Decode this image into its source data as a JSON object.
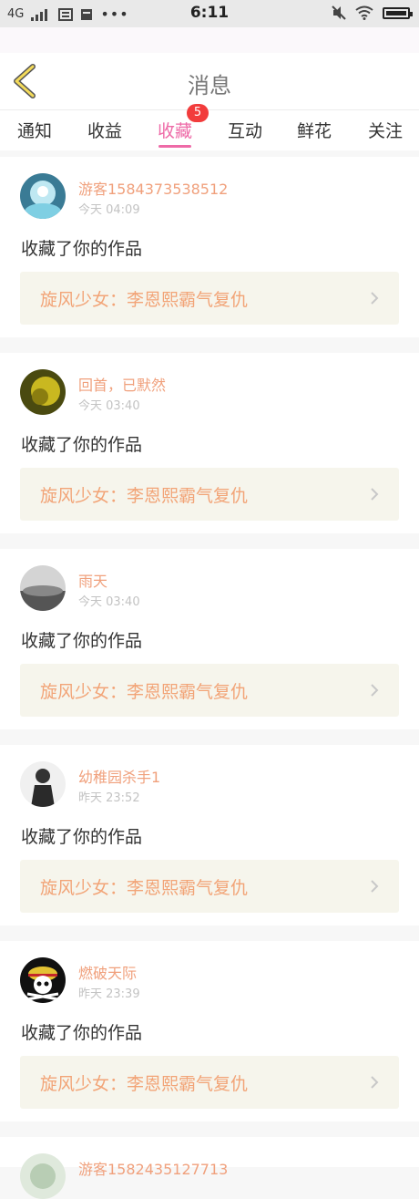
{
  "status_bar": {
    "network": "4G",
    "time": "6:11"
  },
  "header": {
    "title": "消息"
  },
  "tabs": [
    {
      "label": "通知"
    },
    {
      "label": "收益"
    },
    {
      "label": "收藏",
      "active": true,
      "badge": "5"
    },
    {
      "label": "互动"
    },
    {
      "label": "鲜花"
    },
    {
      "label": "关注"
    }
  ],
  "messages": [
    {
      "username": "游客1584373538512",
      "time": "今天 04:09",
      "action": "收藏了你的作品",
      "work": "旋风少女：李恩熙霸气复仇"
    },
    {
      "username": "回首，已默然",
      "time": "今天 03:40",
      "action": "收藏了你的作品",
      "work": "旋风少女：李恩熙霸气复仇"
    },
    {
      "username": "雨天",
      "time": "今天 03:40",
      "action": "收藏了你的作品",
      "work": "旋风少女：李恩熙霸气复仇"
    },
    {
      "username": "幼稚园杀手1",
      "time": "昨天 23:52",
      "action": "收藏了你的作品",
      "work": "旋风少女：李恩熙霸气复仇"
    },
    {
      "username": "燃破天际",
      "time": "昨天 23:39",
      "action": "收藏了你的作品",
      "work": "旋风少女：李恩熙霸气复仇"
    },
    {
      "username": "游客1582435127713"
    }
  ],
  "colors": {
    "accent_pink": "#ee6aa7",
    "username_orange": "#f0a07c",
    "work_text": "#f2a477",
    "badge_red": "#f23c3c"
  }
}
